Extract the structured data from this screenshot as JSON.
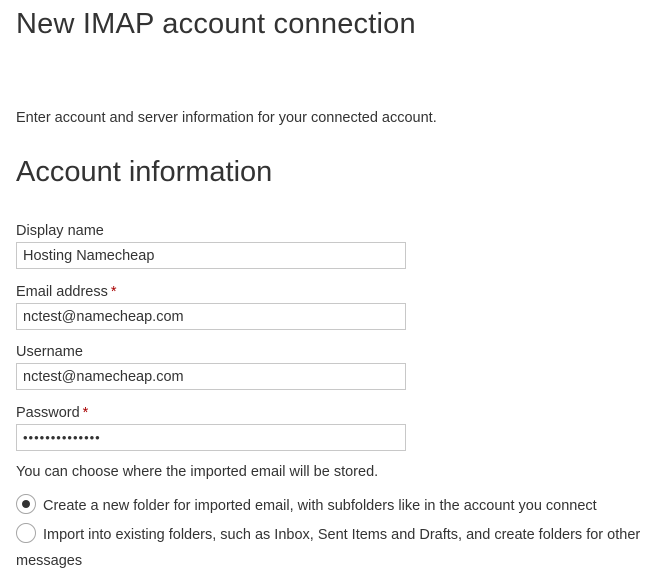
{
  "page": {
    "title": "New IMAP account connection",
    "intro": "Enter account and server information for your connected account."
  },
  "account_section": {
    "title": "Account information",
    "required_mark": "*",
    "fields": {
      "display_name": {
        "label": "Display name",
        "value": "Hosting Namecheap"
      },
      "email": {
        "label": "Email address",
        "value": "nctest@namecheap.com"
      },
      "username": {
        "label": "Username",
        "value": "nctest@namecheap.com"
      },
      "password": {
        "label": "Password",
        "value": "••••••••••••••"
      }
    }
  },
  "storage": {
    "note": "You can choose where the imported email will be stored.",
    "options": [
      {
        "label": "Create a new folder for imported email, with subfolders like in the account you connect",
        "selected": true
      },
      {
        "label": "Import into existing folders, such as Inbox, Sent Items and Drafts, and create folders for other messages",
        "selected": false
      }
    ]
  }
}
